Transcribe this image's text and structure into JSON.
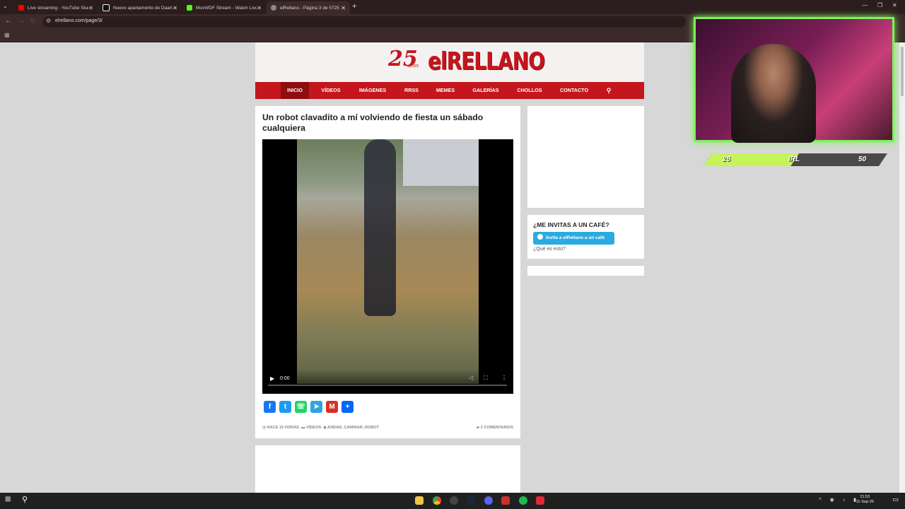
{
  "browser": {
    "tabs": [
      {
        "title": "Live streaming - YouTube Studio",
        "active": false
      },
      {
        "title": "Nuevo apartamento de Daaric…",
        "active": false
      },
      {
        "title": "MoxWDF Stream - Watch Live …",
        "active": false
      },
      {
        "title": "elRellano - Página 3 de 5725 - …",
        "active": true
      }
    ],
    "url": "elrellano.com/page/3/"
  },
  "site": {
    "logo_number": "25",
    "logo_years": "años",
    "logo_word": "elRELLANO",
    "nav": [
      "INICIO",
      "VÍDEOS",
      "IMÁGENES",
      "RRSS",
      "MEMES",
      "GALERÍAS",
      "CHOLLOS",
      "CONTACTO"
    ],
    "active_nav": "INICIO"
  },
  "article": {
    "title": "Un robot clavadito a mí volviendo de fiesta un sábado cualquiera",
    "video_time": "0:00",
    "meta_time": "HACE 15 HORAS",
    "meta_category": "VÍDEOS",
    "meta_tags": "ANDAR, CAMINAR, ROBOT",
    "comments": "2 COMENTARIOS"
  },
  "sidebar": {
    "coffee_title": "¿ME INVITAS A UN CAFÉ?",
    "coffee_button": "Invita a elRellano a un café",
    "coffee_help": "¿Qué es esto?"
  },
  "stream": {
    "bar_left": "26",
    "bar_mid": "IRL",
    "bar_right": "50",
    "progress_fraction": 0.52
  },
  "taskbar": {
    "time": "21:53",
    "date": "11-Sep-25"
  },
  "colors": {
    "brand_red": "#c4161c",
    "overlay_green": "#7cf25a",
    "coffee_blue": "#29abe0"
  }
}
